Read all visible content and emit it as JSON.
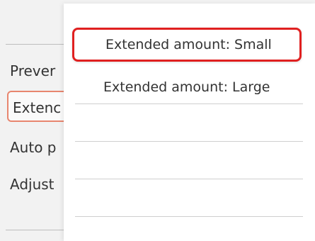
{
  "background_menu": {
    "items": [
      {
        "label": "Prever",
        "selected": false
      },
      {
        "label": "Extenc",
        "selected": true
      },
      {
        "label": "Auto p",
        "selected": false
      },
      {
        "label": "Adjust",
        "selected": false
      }
    ]
  },
  "popup": {
    "options": [
      {
        "label": "Extended amount: Small",
        "selected": true
      },
      {
        "label": "Extended amount: Large",
        "selected": false
      }
    ]
  },
  "colors": {
    "selection_border": "#e02020",
    "background_selection_border": "#e8866f"
  }
}
